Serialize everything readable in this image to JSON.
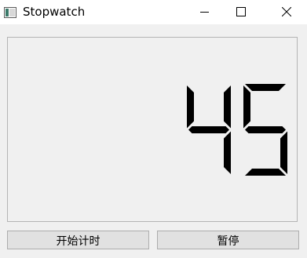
{
  "window": {
    "title": "Stopwatch",
    "icons": {
      "app": "app-window-icon",
      "minimize": "minimize-icon",
      "maximize": "maximize-icon",
      "close": "close-icon"
    }
  },
  "display": {
    "value": "45"
  },
  "buttons": {
    "start_label": "开始计时",
    "pause_label": "暂停"
  },
  "colors": {
    "segment": "#000000",
    "background": "#f0f0f0",
    "titlebar": "#ffffff",
    "button": "#e1e1e1"
  }
}
